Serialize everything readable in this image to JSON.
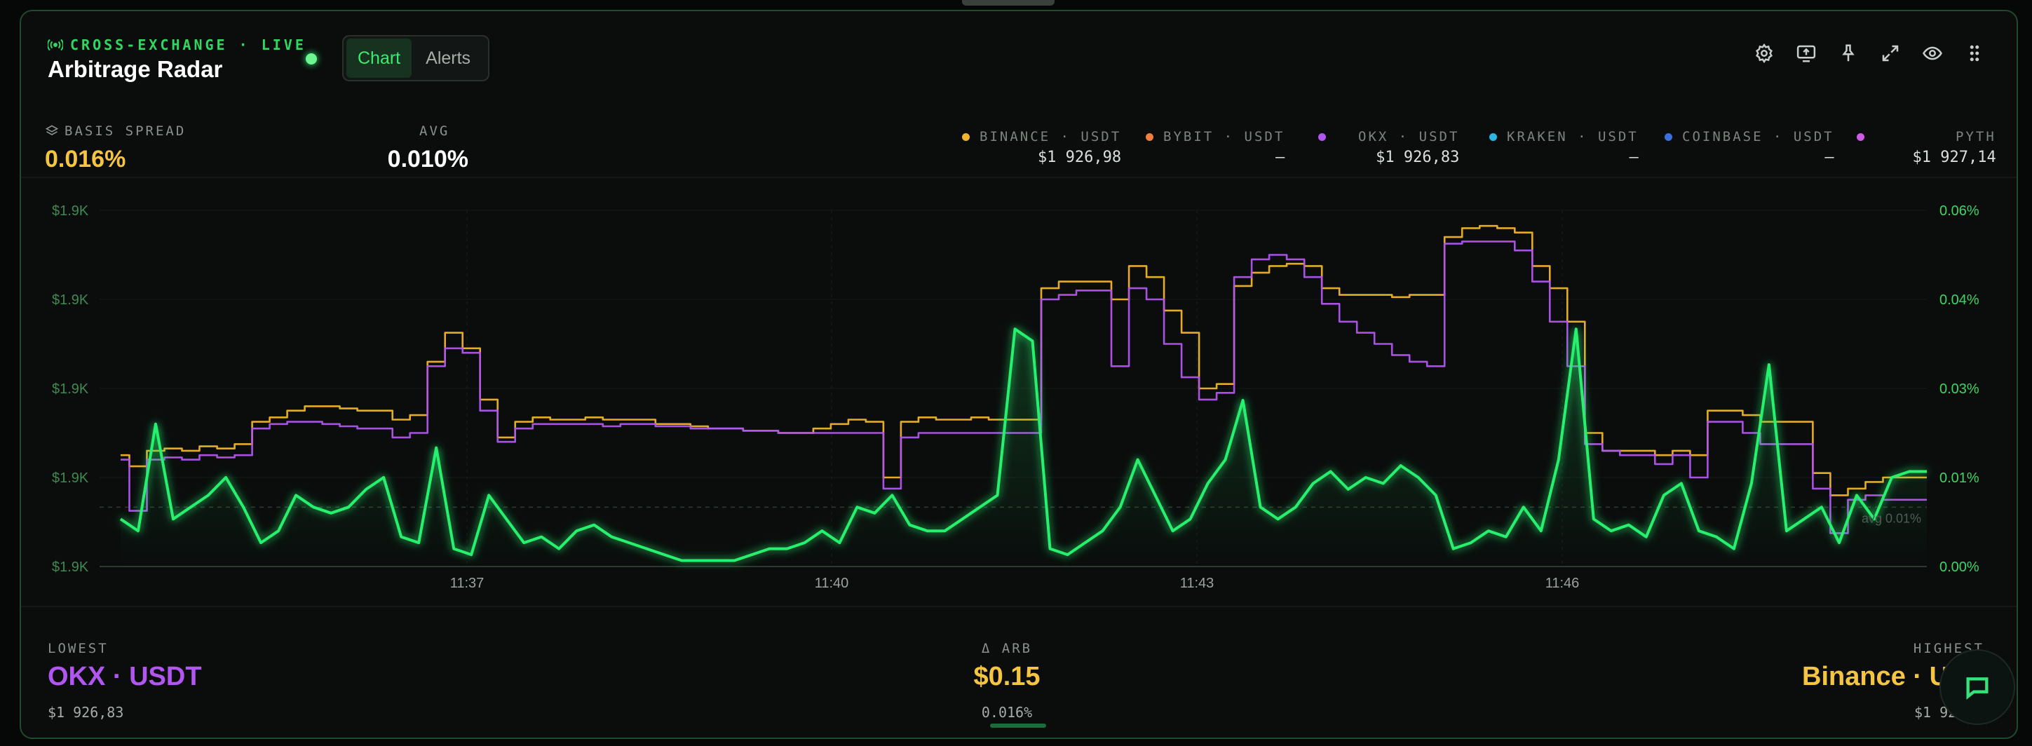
{
  "header": {
    "live_label": "CROSS-EXCHANGE · LIVE",
    "title": "Arbitrage Radar",
    "tabs": [
      {
        "label": "Chart",
        "active": true
      },
      {
        "label": "Alerts",
        "active": false
      }
    ],
    "toolbar_icons": [
      "gear-icon",
      "share-screen-icon",
      "pin-icon",
      "expand-icon",
      "eye-icon",
      "more-vertical-icon"
    ]
  },
  "stats": {
    "basis_label": "BASIS SPREAD",
    "basis_value": "0.016%",
    "avg_label": "AVG",
    "avg_value": "0.010%"
  },
  "legend": [
    {
      "name": "BINANCE · USDT",
      "price": "$1 926,98",
      "color": "#f0b429"
    },
    {
      "name": "BYBIT · USDT",
      "price": "—",
      "color": "#f07f3c"
    },
    {
      "name": "OKX · USDT",
      "price": "$1 926,83",
      "color": "#b156f0"
    },
    {
      "name": "KRAKEN · USDT",
      "price": "—",
      "color": "#2bb7e6"
    },
    {
      "name": "COINBASE · USDT",
      "price": "—",
      "color": "#3b6fe0"
    },
    {
      "name": "PYTH",
      "price": "$1 927,14",
      "color": "#d05ae8"
    }
  ],
  "chart_data": {
    "type": "line",
    "left_axis_ticks": [
      "$1.9K",
      "$1.9K",
      "$1.9K",
      "$1.9K",
      "$1.9K"
    ],
    "right_axis_ticks": [
      "0.06%",
      "0.04%",
      "0.03%",
      "0.01%",
      "0.00%"
    ],
    "x_ticks": [
      "11:37",
      "11:40",
      "11:43",
      "11:46"
    ],
    "avg_line_label": "avg 0.01%",
    "avg_value": 0.01,
    "right_ylim": [
      0,
      0.06
    ],
    "price_ylim": [
      1926.2,
      1927.8
    ],
    "series": [
      {
        "name": "BINANCE · USDT",
        "color": "#f0b429",
        "axis": "price",
        "values": [
          1926.7,
          1926.65,
          1926.72,
          1926.73,
          1926.72,
          1926.74,
          1926.73,
          1926.75,
          1926.85,
          1926.87,
          1926.9,
          1926.92,
          1926.92,
          1926.91,
          1926.9,
          1926.9,
          1926.86,
          1926.88,
          1927.12,
          1927.25,
          1927.18,
          1926.95,
          1926.78,
          1926.85,
          1926.87,
          1926.86,
          1926.86,
          1926.87,
          1926.86,
          1926.86,
          1926.86,
          1926.84,
          1926.84,
          1926.83,
          1926.82,
          1926.82,
          1926.81,
          1926.81,
          1926.8,
          1926.8,
          1926.82,
          1926.84,
          1926.86,
          1926.85,
          1926.6,
          1926.85,
          1926.87,
          1926.86,
          1926.86,
          1926.87,
          1926.86,
          1926.86,
          1926.86,
          1927.45,
          1927.48,
          1927.48,
          1927.48,
          1927.4,
          1927.55,
          1927.5,
          1927.35,
          1927.25,
          1927.0,
          1927.02,
          1927.46,
          1927.52,
          1927.55,
          1927.56,
          1927.55,
          1927.45,
          1927.42,
          1927.42,
          1927.42,
          1927.41,
          1927.42,
          1927.42,
          1927.68,
          1927.72,
          1927.73,
          1927.72,
          1927.7,
          1927.55,
          1927.45,
          1927.3,
          1926.8,
          1926.72,
          1926.72,
          1926.72,
          1926.7,
          1926.72,
          1926.7,
          1926.9,
          1926.9,
          1926.88,
          1926.85,
          1926.85,
          1926.85,
          1926.62,
          1926.52,
          1926.55,
          1926.58,
          1926.6,
          1926.6,
          1926.6
        ]
      },
      {
        "name": "OKX · USDT",
        "color": "#b156f0",
        "axis": "price",
        "values": [
          1926.68,
          1926.45,
          1926.68,
          1926.69,
          1926.68,
          1926.7,
          1926.69,
          1926.7,
          1926.82,
          1926.84,
          1926.85,
          1926.85,
          1926.84,
          1926.83,
          1926.82,
          1926.82,
          1926.78,
          1926.8,
          1927.1,
          1927.18,
          1927.16,
          1926.9,
          1926.76,
          1926.82,
          1926.84,
          1926.84,
          1926.84,
          1926.84,
          1926.83,
          1926.84,
          1926.84,
          1926.83,
          1926.83,
          1926.82,
          1926.82,
          1926.82,
          1926.81,
          1926.81,
          1926.8,
          1926.8,
          1926.8,
          1926.8,
          1926.8,
          1926.8,
          1926.55,
          1926.78,
          1926.8,
          1926.8,
          1926.8,
          1926.8,
          1926.8,
          1926.8,
          1926.8,
          1927.4,
          1927.42,
          1927.44,
          1927.44,
          1927.1,
          1927.45,
          1927.4,
          1927.2,
          1927.05,
          1926.95,
          1926.98,
          1927.5,
          1927.58,
          1927.6,
          1927.58,
          1927.5,
          1927.38,
          1927.3,
          1927.25,
          1927.2,
          1927.15,
          1927.12,
          1927.1,
          1927.65,
          1927.66,
          1927.66,
          1927.66,
          1927.62,
          1927.48,
          1927.3,
          1927.1,
          1926.75,
          1926.72,
          1926.7,
          1926.7,
          1926.66,
          1926.7,
          1926.6,
          1926.85,
          1926.85,
          1926.8,
          1926.75,
          1926.75,
          1926.75,
          1926.55,
          1926.35,
          1926.5,
          1926.52,
          1926.5,
          1926.5,
          1926.5
        ]
      },
      {
        "name": "BASIS SPREAD",
        "color": "#28f06e",
        "axis": "spread",
        "values": [
          0.008,
          0.006,
          0.024,
          0.008,
          0.01,
          0.012,
          0.015,
          0.01,
          0.004,
          0.006,
          0.012,
          0.01,
          0.009,
          0.01,
          0.013,
          0.015,
          0.005,
          0.004,
          0.02,
          0.003,
          0.002,
          0.012,
          0.008,
          0.004,
          0.005,
          0.003,
          0.006,
          0.007,
          0.005,
          0.004,
          0.003,
          0.002,
          0.001,
          0.001,
          0.001,
          0.001,
          0.002,
          0.003,
          0.003,
          0.004,
          0.006,
          0.004,
          0.01,
          0.009,
          0.012,
          0.007,
          0.006,
          0.006,
          0.008,
          0.01,
          0.012,
          0.04,
          0.038,
          0.003,
          0.002,
          0.004,
          0.006,
          0.01,
          0.018,
          0.012,
          0.006,
          0.008,
          0.014,
          0.018,
          0.028,
          0.01,
          0.008,
          0.01,
          0.014,
          0.016,
          0.013,
          0.015,
          0.014,
          0.017,
          0.015,
          0.012,
          0.003,
          0.004,
          0.006,
          0.005,
          0.01,
          0.006,
          0.018,
          0.04,
          0.008,
          0.006,
          0.007,
          0.005,
          0.012,
          0.014,
          0.006,
          0.005,
          0.003,
          0.014,
          0.034,
          0.006,
          0.008,
          0.01,
          0.004,
          0.012,
          0.008,
          0.015,
          0.016,
          0.016
        ]
      }
    ]
  },
  "footer": {
    "lowest_label": "LOWEST",
    "lowest_name": "OKX · USDT",
    "lowest_price": "$1 926,83",
    "arb_label": "Δ ARB",
    "arb_value": "$0.15",
    "arb_pct": "0.016%",
    "highest_label": "HIGHEST",
    "highest_name": "Binance · USDT",
    "highest_price": "$1 926,98"
  },
  "colors": {
    "accent": "#2fd85e",
    "basis": "#f5c542",
    "lowest": "#b156f0",
    "highest": "#f5c542"
  }
}
